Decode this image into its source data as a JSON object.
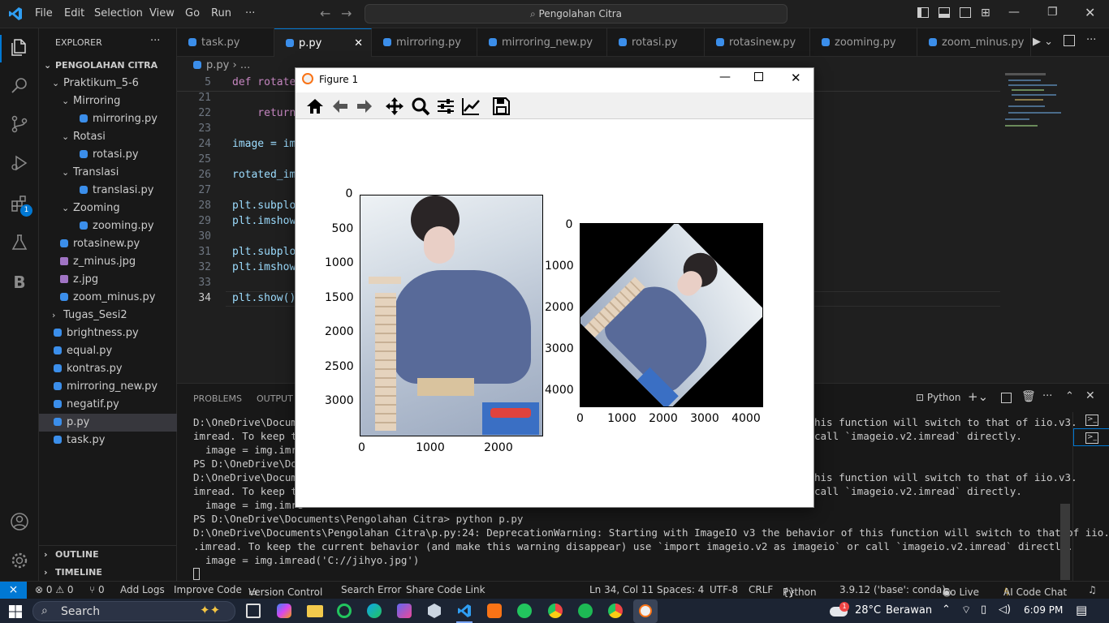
{
  "titlebar": {
    "menus": [
      "File",
      "Edit",
      "Selection",
      "View",
      "Go",
      "Run",
      "···"
    ],
    "search_text": "Pengolahan Citra"
  },
  "activity": {
    "extensions_badge": "1"
  },
  "explorer": {
    "title": "EXPLORER",
    "more": "···",
    "root": "PENGOLAHAN CITRA",
    "items": [
      {
        "label": "Praktikum_5-6",
        "kind": "folder-open"
      },
      {
        "label": "Mirroring",
        "kind": "folder-open"
      },
      {
        "label": "mirroring.py",
        "kind": "py"
      },
      {
        "label": "Rotasi",
        "kind": "folder-open"
      },
      {
        "label": "rotasi.py",
        "kind": "py"
      },
      {
        "label": "Translasi",
        "kind": "folder-open"
      },
      {
        "label": "translasi.py",
        "kind": "py"
      },
      {
        "label": "Zooming",
        "kind": "folder-open"
      },
      {
        "label": "zooming.py",
        "kind": "py"
      },
      {
        "label": "rotasinew.py",
        "kind": "py"
      },
      {
        "label": "z_minus.jpg",
        "kind": "img"
      },
      {
        "label": "z.jpg",
        "kind": "img"
      },
      {
        "label": "zoom_minus.py",
        "kind": "py"
      },
      {
        "label": "Tugas_Sesi2",
        "kind": "folder-closed"
      },
      {
        "label": "brightness.py",
        "kind": "py"
      },
      {
        "label": "equal.py",
        "kind": "py"
      },
      {
        "label": "kontras.py",
        "kind": "py"
      },
      {
        "label": "mirroring_new.py",
        "kind": "py"
      },
      {
        "label": "negatif.py",
        "kind": "py"
      },
      {
        "label": "p.py",
        "kind": "py"
      },
      {
        "label": "task.py",
        "kind": "py"
      }
    ],
    "outline": "OUTLINE",
    "timeline": "TIMELINE"
  },
  "tabs": [
    "task.py",
    "p.py",
    "mirroring.py",
    "mirroring_new.py",
    "rotasi.py",
    "rotasinew.py",
    "zooming.py",
    "zoom_minus.py"
  ],
  "breadcrumb": {
    "file": "p.py",
    "rest": "..."
  },
  "code_lines": [
    {
      "n": "5",
      "text": "def rotate"
    },
    {
      "n": "21",
      "text": ""
    },
    {
      "n": "22",
      "text": "    return"
    },
    {
      "n": "23",
      "text": ""
    },
    {
      "n": "24",
      "text": "image = im"
    },
    {
      "n": "25",
      "text": ""
    },
    {
      "n": "26",
      "text": "rotated_im"
    },
    {
      "n": "27",
      "text": ""
    },
    {
      "n": "28",
      "text": "plt.subplo"
    },
    {
      "n": "29",
      "text": "plt.imshow"
    },
    {
      "n": "30",
      "text": ""
    },
    {
      "n": "31",
      "text": "plt.subplo"
    },
    {
      "n": "32",
      "text": "plt.imshow"
    },
    {
      "n": "33",
      "text": ""
    },
    {
      "n": "34",
      "text": "plt.show()"
    }
  ],
  "panel": {
    "tabs": [
      "PROBLEMS",
      "OUTPUT"
    ],
    "shell": "Python",
    "lines": [
      "D:\\OneDrive\\Docume",
      "imread. To keep th",
      "  image = img.imre",
      "PS D:\\OneDrive\\Doc",
      "D:\\OneDrive\\Docume",
      "imread. To keep th",
      "  image = img.imre",
      "PS D:\\OneDrive\\Documents\\Pengolahan Citra> python p.py",
      "D:\\OneDrive\\Documents\\Pengolahan Citra\\p.py:24: DeprecationWarning: Starting with ImageIO v3 the behavior of this function will switch to that of iio.v3",
      ".imread. To keep the current behavior (and make this warning disappear) use `import imageio.v2 as imageio` or call `imageio.v2.imread` directly.",
      "  image = img.imread('C://jihyo.jpg')"
    ],
    "right_lines": [
      "his function will switch to that of iio.v3.",
      "call `imageio.v2.imread` directly.",
      "",
      "",
      "his function will switch to that of iio.v3.",
      "call `imageio.v2.imread` directly."
    ]
  },
  "status": {
    "remote": "⨯",
    "problems": "⊗ 0 ⚠ 0",
    "ports": "⑂ 0",
    "add_logs": "Add Logs",
    "improve_code": "Improve Code",
    "version_control": "Version Control",
    "search_error": "Search Error",
    "share_code_link": "Share Code Link",
    "position": "Ln 34, Col 11",
    "spaces": "Spaces: 4",
    "encoding": "UTF-8",
    "eol": "CRLF",
    "language": "Python",
    "interpreter": "3.9.12 ('base': conda)",
    "go_live": "Go Live",
    "ai_chat": "AI Code Chat"
  },
  "figure": {
    "title": "Figure 1",
    "left_plot": {
      "y_ticks": [
        "0",
        "500",
        "1000",
        "1500",
        "2000",
        "2500",
        "3000"
      ],
      "x_ticks": [
        "0",
        "1000",
        "2000"
      ]
    },
    "right_plot": {
      "y_ticks": [
        "0",
        "1000",
        "2000",
        "3000",
        "4000"
      ],
      "x_ticks": [
        "0",
        "1000",
        "2000",
        "3000",
        "4000"
      ]
    }
  },
  "taskbar": {
    "search": "Search",
    "weather_temp": "28°C",
    "weather_desc": "Berawan",
    "time": "6:09 PM"
  }
}
